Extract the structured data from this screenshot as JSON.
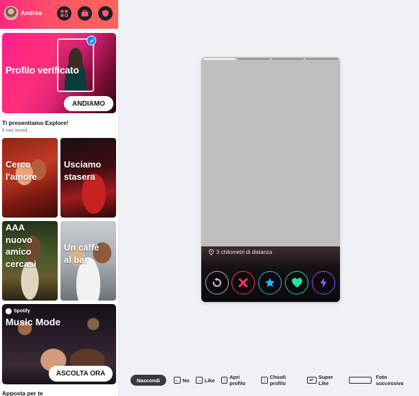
{
  "header": {
    "username": "Andrea",
    "buttons": [
      "explore-icon",
      "work-icon",
      "safety-shield-icon"
    ]
  },
  "verified_card": {
    "title": "Profilo verificato",
    "button": "ANDIAMO"
  },
  "explore": {
    "title": "Ti presentiamo Explore!",
    "subtitle": "Il mio mood...",
    "tiles": [
      {
        "label_lines": [
          "Cerco",
          "l'amore"
        ]
      },
      {
        "label_lines": [
          "Usciamo",
          "stasera"
        ]
      },
      {
        "label_lines": [
          "AAA",
          "nuovo",
          "amico",
          "cercasi"
        ]
      },
      {
        "label_lines": [
          "Un caffè",
          "al bar"
        ]
      }
    ]
  },
  "spotify_card": {
    "brand": "Spotify",
    "title": "Music Mode",
    "button": "ASCOLTA ORA"
  },
  "next_section": "Apposta per te",
  "profile": {
    "photo_count": 4,
    "active_photo": 0,
    "distance": "3 chilometri di distanza",
    "actions": [
      {
        "name": "rewind",
        "color": "#b8b8b8"
      },
      {
        "name": "nope",
        "color": "#fd3b5a"
      },
      {
        "name": "super-like",
        "color": "#2db4ff"
      },
      {
        "name": "like",
        "color": "#26e0a0"
      },
      {
        "name": "boost",
        "color": "#a84bff"
      }
    ]
  },
  "shortcuts": {
    "hide_label": "Nascondi",
    "items": [
      {
        "key": "←",
        "label": "No"
      },
      {
        "key": "→",
        "label": "Like"
      },
      {
        "key": "↑",
        "label": "Apri profilo"
      },
      {
        "key": "↓",
        "label": "Chiudi profilo"
      },
      {
        "key": "↵",
        "label": "Super Like"
      },
      {
        "key": "",
        "label": "Foto successiva"
      }
    ]
  }
}
